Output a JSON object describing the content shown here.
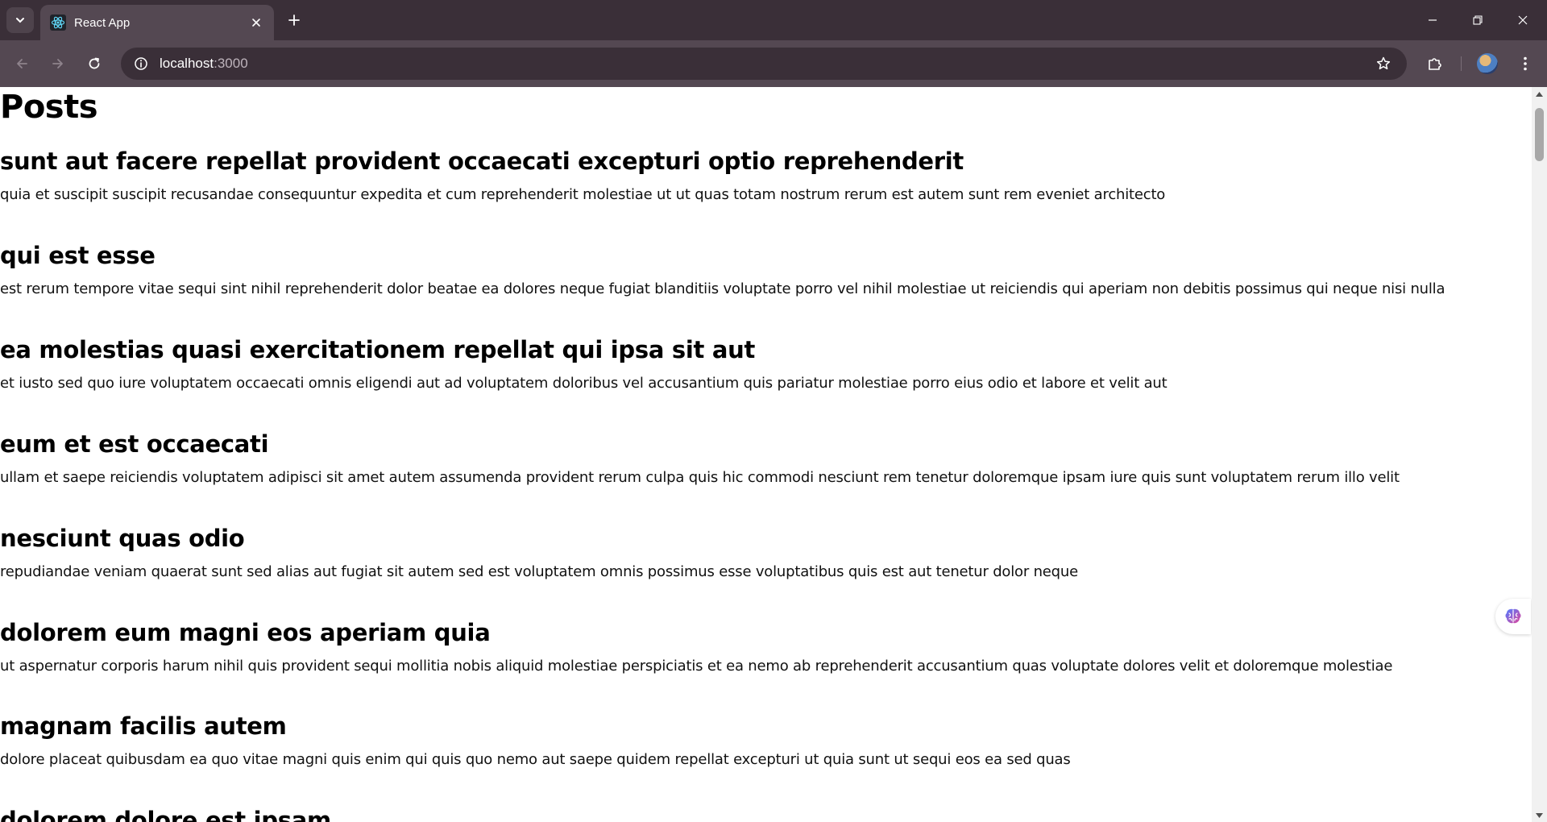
{
  "browser": {
    "tab_title": "React App",
    "url_host": "localhost",
    "url_port": ":3000"
  },
  "page": {
    "heading": "Posts",
    "posts": [
      {
        "title": "sunt aut facere repellat provident occaecati excepturi optio reprehenderit",
        "body": "quia et suscipit suscipit recusandae consequuntur expedita et cum reprehenderit molestiae ut ut quas totam nostrum rerum est autem sunt rem eveniet architecto"
      },
      {
        "title": "qui est esse",
        "body": "est rerum tempore vitae sequi sint nihil reprehenderit dolor beatae ea dolores neque fugiat blanditiis voluptate porro vel nihil molestiae ut reiciendis qui aperiam non debitis possimus qui neque nisi nulla"
      },
      {
        "title": "ea molestias quasi exercitationem repellat qui ipsa sit aut",
        "body": "et iusto sed quo iure voluptatem occaecati omnis eligendi aut ad voluptatem doloribus vel accusantium quis pariatur molestiae porro eius odio et labore et velit aut"
      },
      {
        "title": "eum et est occaecati",
        "body": "ullam et saepe reiciendis voluptatem adipisci sit amet autem assumenda provident rerum culpa quis hic commodi nesciunt rem tenetur doloremque ipsam iure quis sunt voluptatem rerum illo velit"
      },
      {
        "title": "nesciunt quas odio",
        "body": "repudiandae veniam quaerat sunt sed alias aut fugiat sit autem sed est voluptatem omnis possimus esse voluptatibus quis est aut tenetur dolor neque"
      },
      {
        "title": "dolorem eum magni eos aperiam quia",
        "body": "ut aspernatur corporis harum nihil quis provident sequi mollitia nobis aliquid molestiae perspiciatis et ea nemo ab reprehenderit accusantium quas voluptate dolores velit et doloremque molestiae"
      },
      {
        "title": "magnam facilis autem",
        "body": "dolore placeat quibusdam ea quo vitae magni quis enim qui quis quo nemo aut saepe quidem repellat excepturi ut quia sunt ut sequi eos ea sed quas"
      },
      {
        "title": "dolorem dolore est ipsam",
        "body": ""
      }
    ]
  },
  "icons": {
    "tab_search": "chevron-down-icon",
    "favicon": "react-logo-icon",
    "close": "close-icon",
    "new_tab": "plus-icon",
    "back": "arrow-left-icon",
    "forward": "arrow-right-icon",
    "reload": "reload-icon",
    "site_info": "info-icon",
    "bookmark": "star-icon",
    "extensions": "puzzle-icon",
    "menu": "kebab-menu-icon",
    "side_extension": "brain-icon"
  },
  "colors": {
    "tabbar": "#3a2f38",
    "toolbar": "#544852",
    "omnibox": "#3a2f38",
    "react": "#61dafb"
  }
}
